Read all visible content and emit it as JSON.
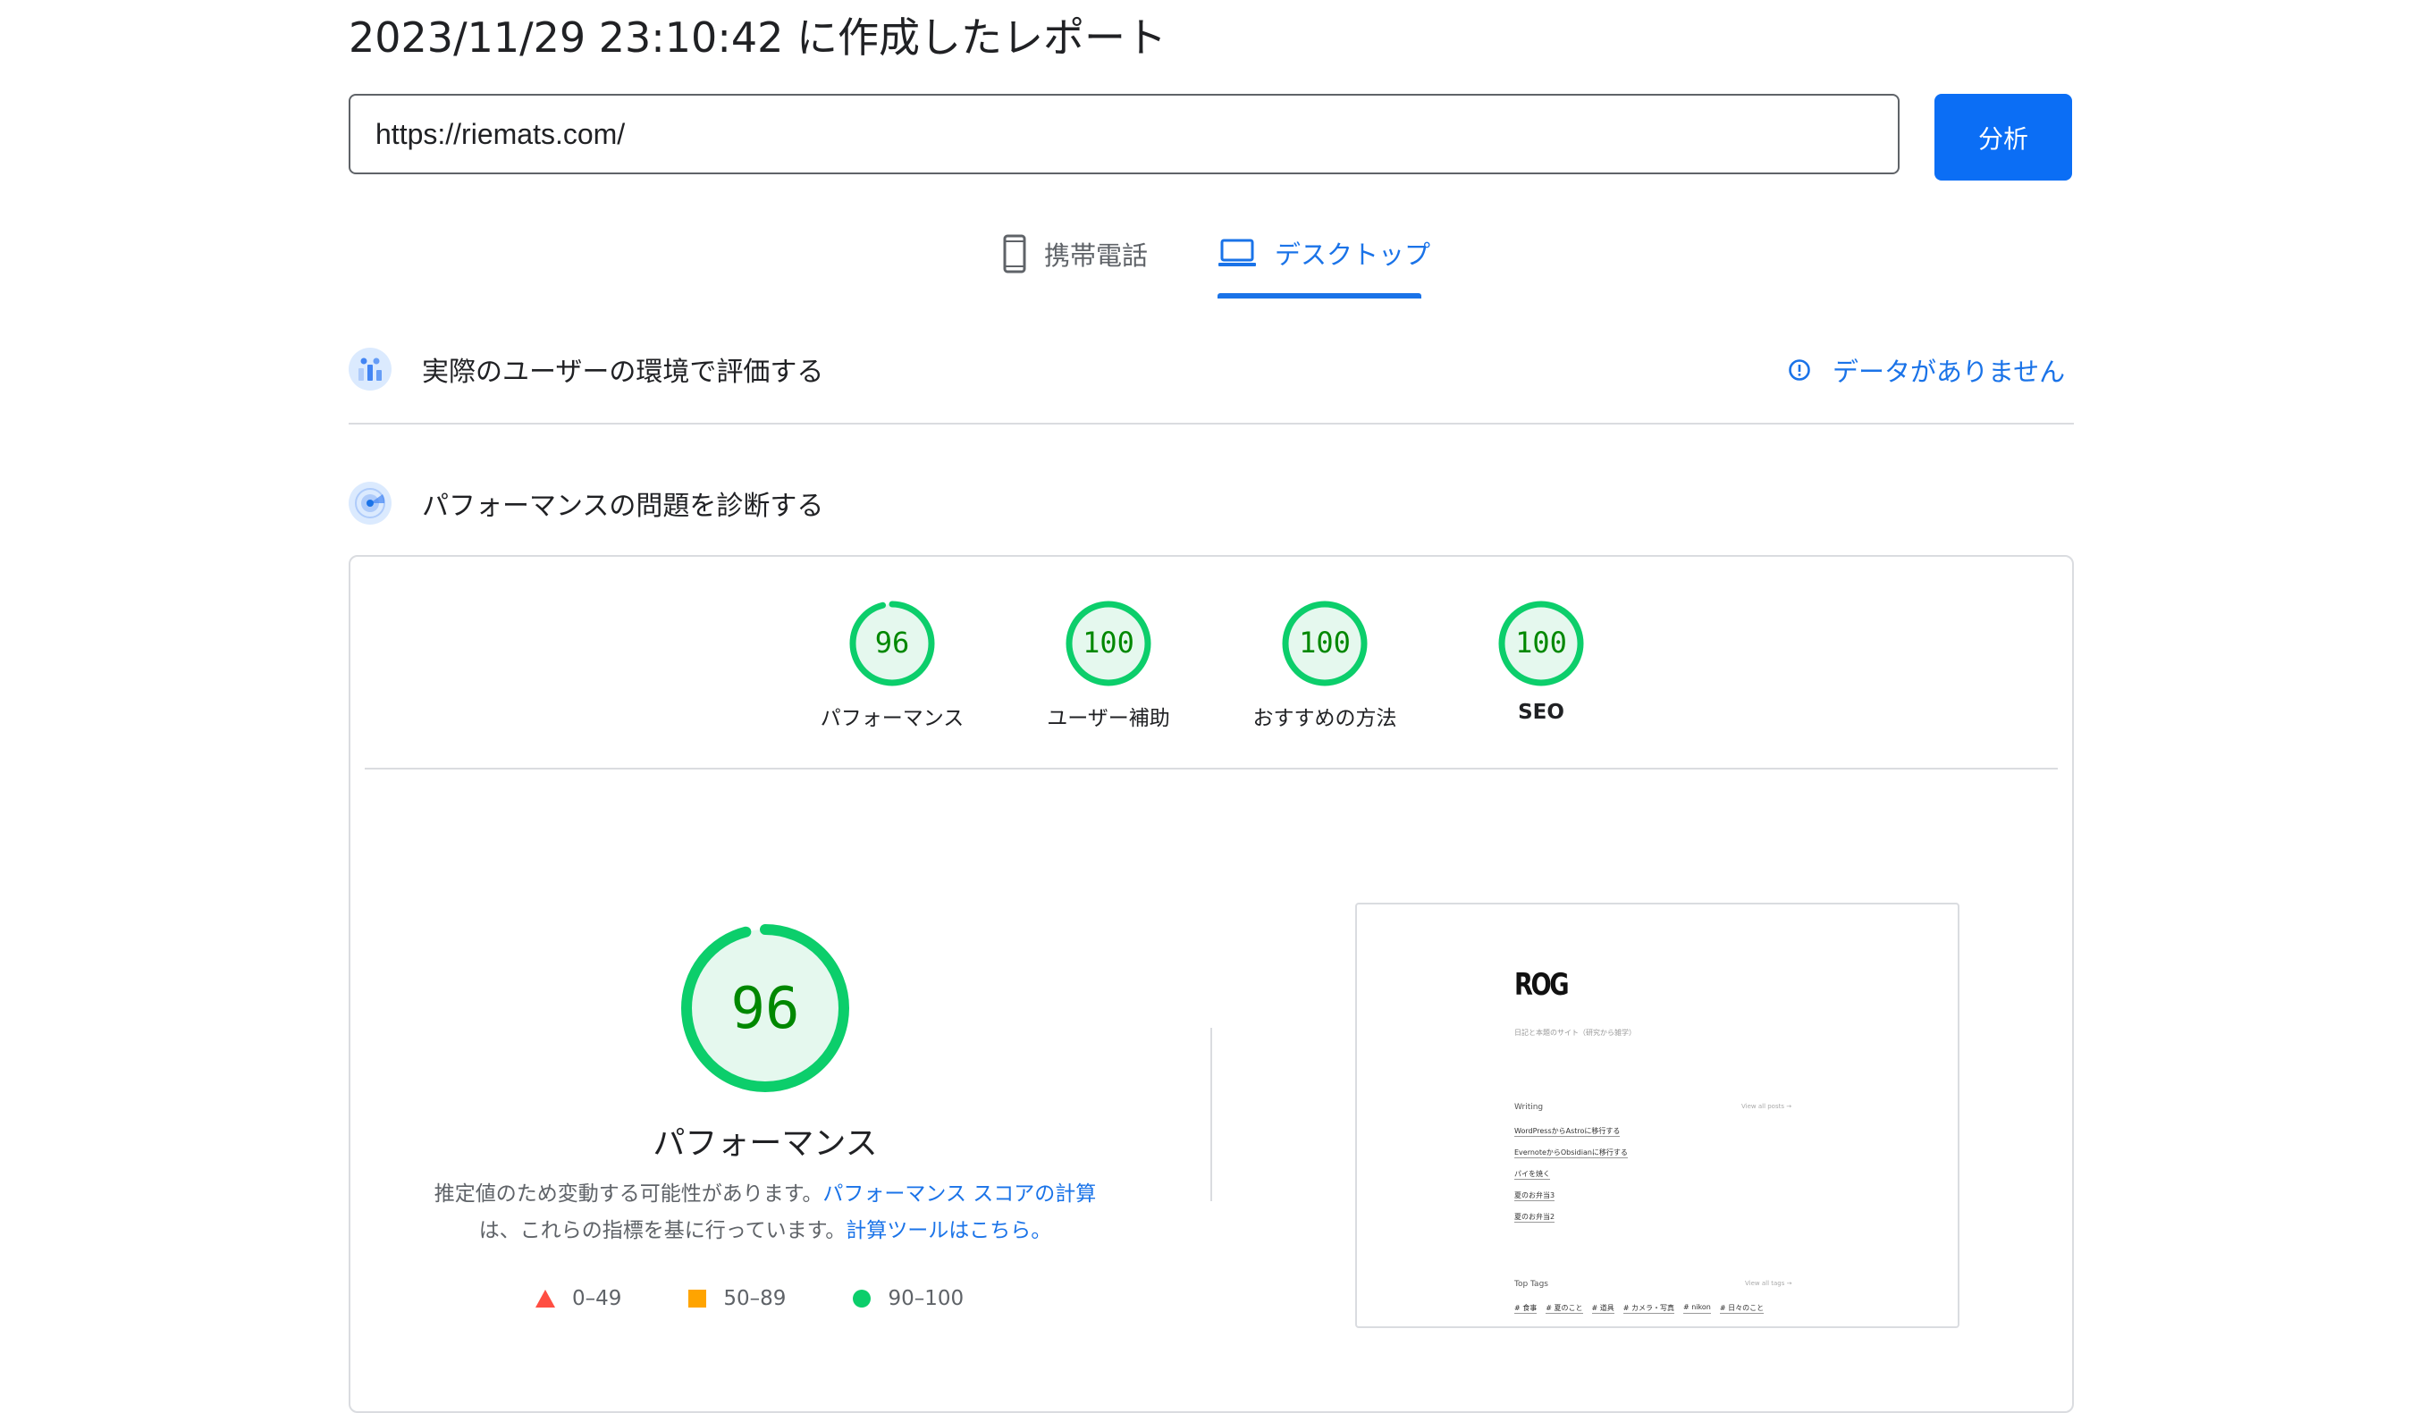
{
  "report": {
    "title": "2023/11/29 23:10:42 に作成したレポート",
    "url_value": "https://riemats.com/",
    "analyze_label": "分析"
  },
  "tabs": [
    {
      "label": "携帯電話",
      "icon": "smartphone-icon",
      "active": false
    },
    {
      "label": "デスクトップ",
      "icon": "laptop-icon",
      "active": true
    }
  ],
  "field_data": {
    "title": "実際のユーザーの環境で評価する",
    "status": "データがありません",
    "icon": "users-chart-icon",
    "status_icon": "info-icon"
  },
  "lab_data": {
    "title": "パフォーマンスの問題を診断する",
    "icon": "radar-icon"
  },
  "categories": [
    {
      "score": 96,
      "label": "パフォーマンス"
    },
    {
      "score": 100,
      "label": "ユーザー補助"
    },
    {
      "score": 100,
      "label": "おすすめの方法"
    },
    {
      "score": 100,
      "label": "SEO"
    }
  ],
  "performance": {
    "score": 96,
    "label": "パフォーマンス",
    "desc_text_1": "推定値のため変動する可能性があります。",
    "desc_link_1": "パフォーマンス スコアの計算",
    "desc_text_2": "は、これらの指標を基に行っています。",
    "desc_link_2": "計算ツールはこちら。"
  },
  "legend": [
    {
      "range": "0–49",
      "color": "#ff4e42",
      "shape": "triangle"
    },
    {
      "range": "50–89",
      "color": "#ffa400",
      "shape": "square"
    },
    {
      "range": "90–100",
      "color": "#0cce6b",
      "shape": "circle"
    }
  ],
  "screenshot": {
    "logo": "ROG",
    "tagline": "日記と本題のサイト（研究から雑学）",
    "writing_heading": "Writing",
    "view_all_posts": "View all posts →",
    "posts": [
      "WordPressからAstroに移行する",
      "EvernoteからObsidianに移行する",
      "パイを焼く",
      "夏のお弁当3",
      "夏のお弁当2"
    ],
    "tags_heading": "Top Tags",
    "view_all_tags": "View all tags →",
    "tags": [
      "# 食事",
      "# 夏のこと",
      "# 道具",
      "# カメラ・写真",
      "# nikon",
      "# 日々のこと"
    ]
  },
  "colors": {
    "pass": "#0cce6b",
    "pass_text": "#008800",
    "pass_bg": "#e5f8ee",
    "accent": "#1a73e8",
    "button": "#0b6ef5"
  }
}
